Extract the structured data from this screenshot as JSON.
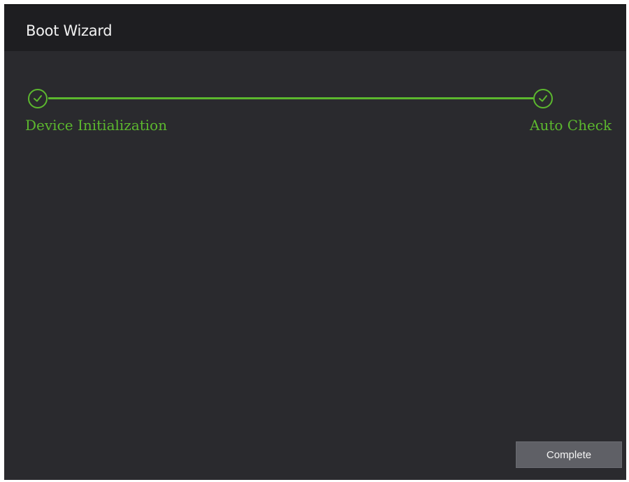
{
  "window": {
    "title": "Boot Wizard"
  },
  "steps": [
    {
      "label": "Device Initialization",
      "status": "completed",
      "icon": "check-circle-icon"
    },
    {
      "label": "Auto Check",
      "status": "completed",
      "icon": "check-circle-icon"
    }
  ],
  "footer": {
    "complete_label": "Complete"
  },
  "colors": {
    "accent": "#5cb82e",
    "background": "#2a2a2e",
    "titlebar": "#1e1e21",
    "button": "#5f6066"
  }
}
